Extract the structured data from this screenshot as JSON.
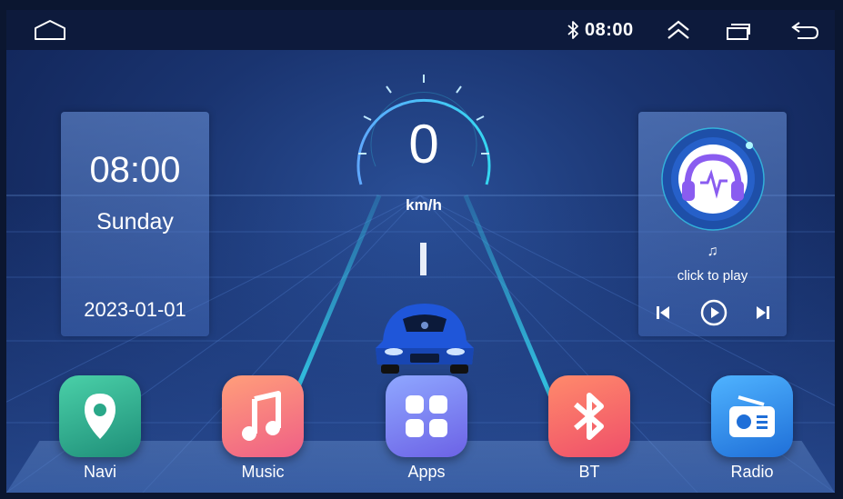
{
  "status_bar": {
    "time": "08:00",
    "icons": [
      "home-icon",
      "bluetooth-icon",
      "chevron-up-icon",
      "recent-apps-icon",
      "back-icon"
    ]
  },
  "clock": {
    "time": "08:00",
    "day": "Sunday",
    "date": "2023-01-01"
  },
  "speedometer": {
    "speed": "0",
    "unit": "km/h"
  },
  "music": {
    "note": "♫",
    "prompt": "click to play",
    "controls": [
      "previous-icon",
      "play-icon",
      "next-icon"
    ]
  },
  "apps": [
    {
      "label": "Navi",
      "icon": "location-pin-icon",
      "color": "#2aa889"
    },
    {
      "label": "Music",
      "icon": "music-note-icon",
      "color": "#f27a7a"
    },
    {
      "label": "Apps",
      "icon": "grid-icon",
      "color": "#7f88f5"
    },
    {
      "label": "BT",
      "icon": "bluetooth-icon",
      "color": "#f56f66"
    },
    {
      "label": "Radio",
      "icon": "radio-icon",
      "color": "#2e8de8"
    }
  ],
  "colors": {
    "accent": "#35d6f0",
    "statusbar": "#0d1a3c"
  }
}
